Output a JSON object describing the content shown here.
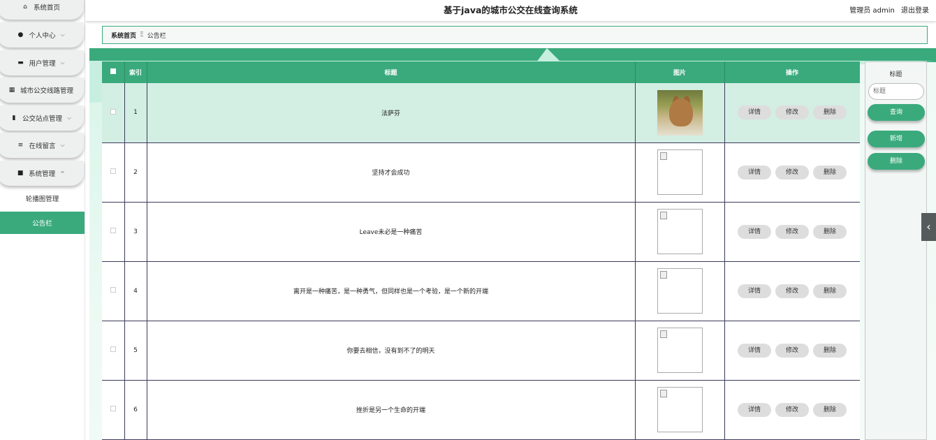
{
  "sidebar": {
    "items": [
      {
        "label": "系统首页",
        "icon": "home-icon",
        "glyph": "⌂",
        "arrow": ""
      },
      {
        "label": "个人中心",
        "icon": "user-icon",
        "glyph": "●",
        "arrow": "⌵"
      },
      {
        "label": "用户管理",
        "icon": "users-icon",
        "glyph": "▬",
        "arrow": "⌵"
      },
      {
        "label": "城市公交线路管理",
        "icon": "grid-icon",
        "glyph": "▦",
        "arrow": ""
      },
      {
        "label": "公交站点管理",
        "icon": "clipboard-icon",
        "glyph": "▮",
        "arrow": "⌵"
      },
      {
        "label": "在线留言",
        "icon": "sliders-icon",
        "glyph": "≡",
        "arrow": "⌵"
      },
      {
        "label": "系统管理",
        "icon": "monitor-icon",
        "glyph": "■",
        "arrow": "^"
      }
    ],
    "sub_items": [
      {
        "label": "轮播图管理",
        "active": false
      },
      {
        "label": "公告栏",
        "active": true
      }
    ]
  },
  "header": {
    "title": "基于java的城市公交在线查询系统",
    "user": "管理员 admin",
    "logout": "退出登录"
  },
  "breadcrumb": {
    "home": "系统首页",
    "separator": "Ξ",
    "current": "公告栏"
  },
  "table": {
    "headers": {
      "index": "索引",
      "title": "标题",
      "image": "图片",
      "action": "操作"
    },
    "rows": [
      {
        "index": "1",
        "title": "法萨芬"
      },
      {
        "index": "2",
        "title": "坚持才会成功"
      },
      {
        "index": "3",
        "title": "Leave未必是一种痛苦"
      },
      {
        "index": "4",
        "title": "离开是一种痛苦，是一种勇气，但同样也是一个考验，是一个新的开端"
      },
      {
        "index": "5",
        "title": "你要去相信，没有到不了的明天"
      },
      {
        "index": "6",
        "title": "挫折是另一个生命的开端"
      }
    ],
    "actions": {
      "detail": "详情",
      "edit": "修改",
      "delete": "删除"
    }
  },
  "search": {
    "label": "标题",
    "placeholder": "标题",
    "query": "查询",
    "add": "新增",
    "delete": "删除"
  },
  "colors": {
    "accent": "#3aaa7d",
    "highlight_row": "#d3eee3"
  }
}
